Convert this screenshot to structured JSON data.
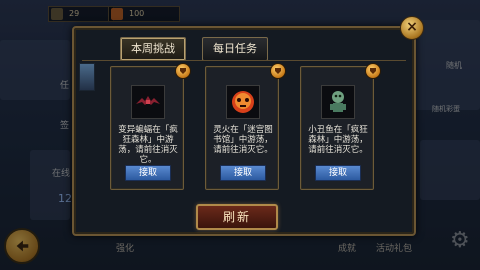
{
  "hud": {
    "resource_1": "29",
    "resource_2": "100"
  },
  "bottom_menu": {
    "item_1": "强化",
    "item_2": "成就",
    "item_3": "活动礼包"
  },
  "side_labels": {
    "left_1": "任",
    "left_2": "签",
    "left_3": "在线",
    "left_4": "12",
    "right_1": "随机",
    "right_2": "随机彩蛋"
  },
  "modal": {
    "close_glyph": "×",
    "tabs": [
      "本周挑战",
      "每日任务"
    ],
    "active_tab": "本周挑战",
    "quests": [
      {
        "text": "变异蝙蝠在「疯狂森林」中游荡，请前往消灭它。",
        "button": "接取"
      },
      {
        "text": "灵火在「迷宫图书馆」中游荡，请前往消灭它。",
        "button": "接取"
      },
      {
        "text": "小丑鱼在「疯狂森林」中游荡，请前往消灭它。",
        "button": "接取"
      }
    ],
    "refresh_label": "刷新"
  },
  "icons": {
    "back": "back-arrow-icon",
    "settings": "gear-icon",
    "badge": "medal-icon"
  }
}
